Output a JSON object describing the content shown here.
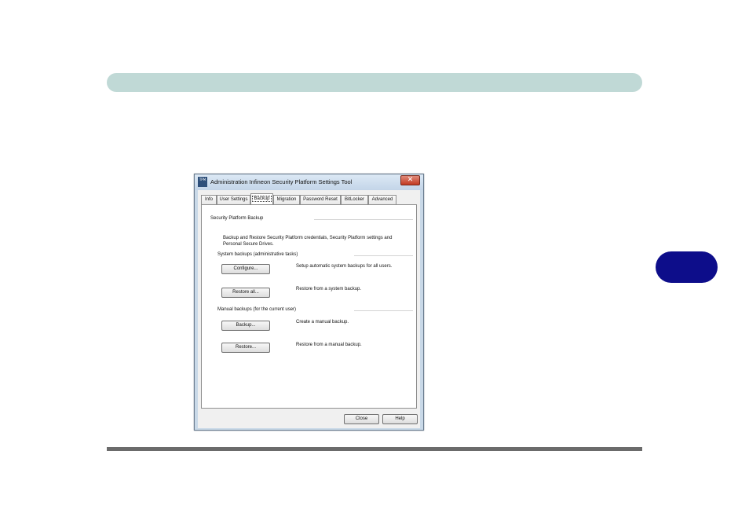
{
  "window": {
    "icon_text": "TPM",
    "title": "Administration Infineon Security Platform Settings Tool",
    "close_glyph": "✕"
  },
  "tabs": [
    {
      "label": "Info"
    },
    {
      "label": "User Settings"
    },
    {
      "label": "Backup"
    },
    {
      "label": "Migration"
    },
    {
      "label": "Password Reset"
    },
    {
      "label": "BitLocker"
    },
    {
      "label": "Advanced"
    }
  ],
  "active_tab": "Backup",
  "backup": {
    "group_title": "Security Platform Backup",
    "description": "Backup and Restore Security Platform credentials, Security Platform settings and Personal Secure Drives.",
    "system": {
      "title": "System backups (administrative tasks)",
      "configure_label": "Configure...",
      "configure_desc": "Setup automatic system backups for all users.",
      "restore_all_label": "Restore all...",
      "restore_all_desc": "Restore from a system backup."
    },
    "manual": {
      "title": "Manual backups (for the current user)",
      "backup_label": "Backup...",
      "backup_desc": "Create a manual backup.",
      "restore_label": "Restore...",
      "restore_desc": "Restore from a manual backup."
    }
  },
  "footer": {
    "close_label": "Close",
    "help_label": "Help"
  },
  "colors": {
    "header_bar": "#c0d9d6",
    "chapter_tab": "#0d0d8a",
    "footer_rule": "#6b6b6b"
  }
}
